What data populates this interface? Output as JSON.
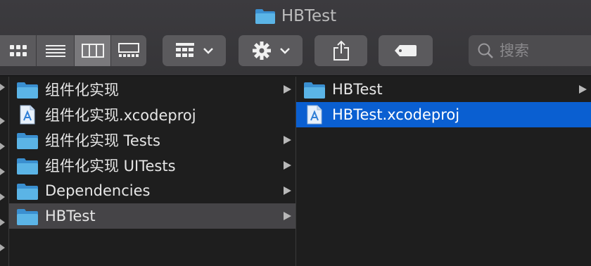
{
  "window": {
    "title": "HBTest"
  },
  "toolbar": {
    "view_buttons": [
      {
        "name": "view-icon-button",
        "icon": "grid-icon"
      },
      {
        "name": "view-list-button",
        "icon": "list-icon"
      },
      {
        "name": "view-column-button",
        "icon": "columns-icon",
        "selected": true
      },
      {
        "name": "view-gallery-button",
        "icon": "gallery-icon"
      }
    ],
    "group_button_icon": "group-icon",
    "action_button_icon": "gear-icon",
    "share_button_icon": "share-icon",
    "tag_button_icon": "tag-icon",
    "search": {
      "placeholder": "搜索",
      "value": ""
    }
  },
  "columns": [
    {
      "items": [
        {
          "label": "组件化实现",
          "icon": "folder-icon",
          "has_children": true
        },
        {
          "label": "组件化实现.xcodeproj",
          "icon": "xcodeproj-icon",
          "has_children": false
        },
        {
          "label": "组件化实现 Tests",
          "icon": "folder-icon",
          "has_children": true
        },
        {
          "label": "组件化实现 UITests",
          "icon": "folder-icon",
          "has_children": true
        },
        {
          "label": "Dependencies",
          "icon": "folder-icon",
          "has_children": true
        },
        {
          "label": "HBTest",
          "icon": "folder-icon",
          "has_children": true,
          "selected": true
        }
      ]
    },
    {
      "items": [
        {
          "label": "HBTest",
          "icon": "folder-icon",
          "has_children": true
        },
        {
          "label": "HBTest.xcodeproj",
          "icon": "xcodeproj-icon",
          "has_children": false,
          "selected": true
        }
      ]
    }
  ],
  "colors": {
    "selection_active": "#0a5fd1",
    "selection_inactive": "#454447",
    "folder": "#4aa3d8"
  }
}
